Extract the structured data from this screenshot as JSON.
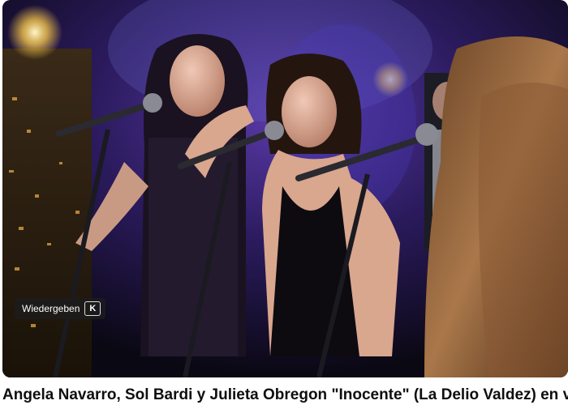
{
  "video": {
    "title": "Angela Navarro, Sol Bardi y Julieta Obregon \"Inocente\" (La Delio Valdez) en vivo",
    "thumbnail_alt": "Tres cantantes en vivo en el escenario con micrófonos"
  },
  "tooltip": {
    "label": "Wiedergeben",
    "shortcut": "K"
  }
}
